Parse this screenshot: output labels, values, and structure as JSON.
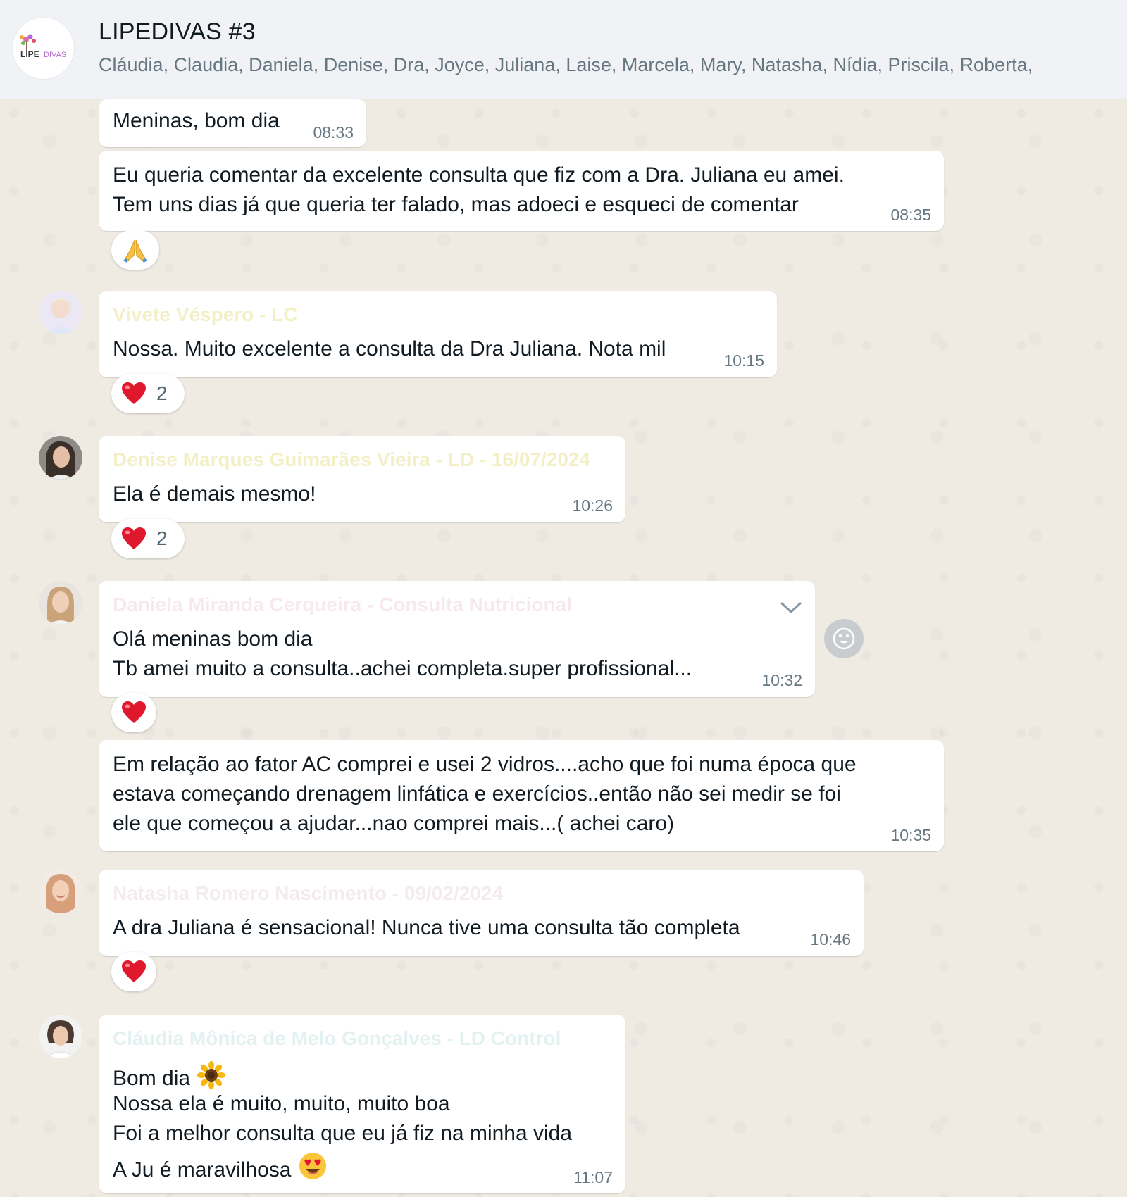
{
  "header": {
    "title": "LIPEDIVAS #3",
    "members": "Cláudia, Claudia, Daniela, Denise, Dra, Joyce, Juliana, Laise, Marcela, Mary, Natasha, Nídia, Priscila, Roberta,",
    "avatar_logo": "LIPEDIVAS"
  },
  "messages": [
    {
      "lines": [
        "Meninas, bom dia"
      ],
      "time": "08:33"
    },
    {
      "lines": [
        "Eu queria comentar da excelente consulta que fiz com a Dra. Juliana  eu amei.",
        "Tem uns dias já que queria ter falado, mas adoeci e esqueci de comentar"
      ],
      "time": "08:35",
      "reaction": "pray-emoji"
    },
    {
      "sender": "Vivete Véspero - LC",
      "lines": [
        "Nossa. Muito excelente a consulta da Dra Juliana. Nota mil"
      ],
      "time": "10:15",
      "reaction": "heart-emoji",
      "reaction_count": "2"
    },
    {
      "sender": "Denise Marques Guimarães Vieira - LD - 16/07/2024",
      "lines": [
        "Ela é demais mesmo!"
      ],
      "time": "10:26",
      "reaction": "heart-emoji",
      "reaction_count": "2"
    },
    {
      "sender": "Daniela Miranda Cerqueira - Consulta Nutricional",
      "lines": [
        "Olá meninas bom dia",
        "Tb amei muito a consulta..achei completa.super profissional..."
      ],
      "time": "10:32",
      "reaction": "heart-emoji"
    },
    {
      "lines": [
        "Em relação ao fator AC comprei e usei 2 vidros....acho que foi numa época que",
        "estava começando drenagem linfática e exercícios..então não sei medir se foi",
        "ele que começou a ajudar...nao comprei mais...( achei caro)"
      ],
      "time": "10:35"
    },
    {
      "sender": "Natasha Romero Nascimento - 09/02/2024",
      "lines": [
        "A dra Juliana é sensacional! Nunca tive uma consulta tão completa"
      ],
      "time": "10:46",
      "reaction": "heart-emoji"
    },
    {
      "sender": "Cláudia Mônica de Melo Gonçalves - LD Control",
      "lines": [
        "Bom dia",
        "Nossa ela é muito, muito, muito boa",
        "Foi a melhor consulta que eu já fiz na minha vida",
        "A Ju é maravilhosa"
      ],
      "line_emojis": [
        "sunflower-emoji",
        "",
        "",
        "heart-eyes-emoji"
      ],
      "time": "11:07"
    }
  ],
  "colors": {
    "chat_bg": "#efeae2",
    "bubble_bg": "#ffffff",
    "header_bg": "#f0f2f5",
    "sender_vivete": "#f3f0c8",
    "sender_denise": "#f3f0c8",
    "sender_daniela": "#f7e9ee",
    "sender_natasha": "#f4ecec",
    "sender_claudia": "#e4f1f1"
  }
}
